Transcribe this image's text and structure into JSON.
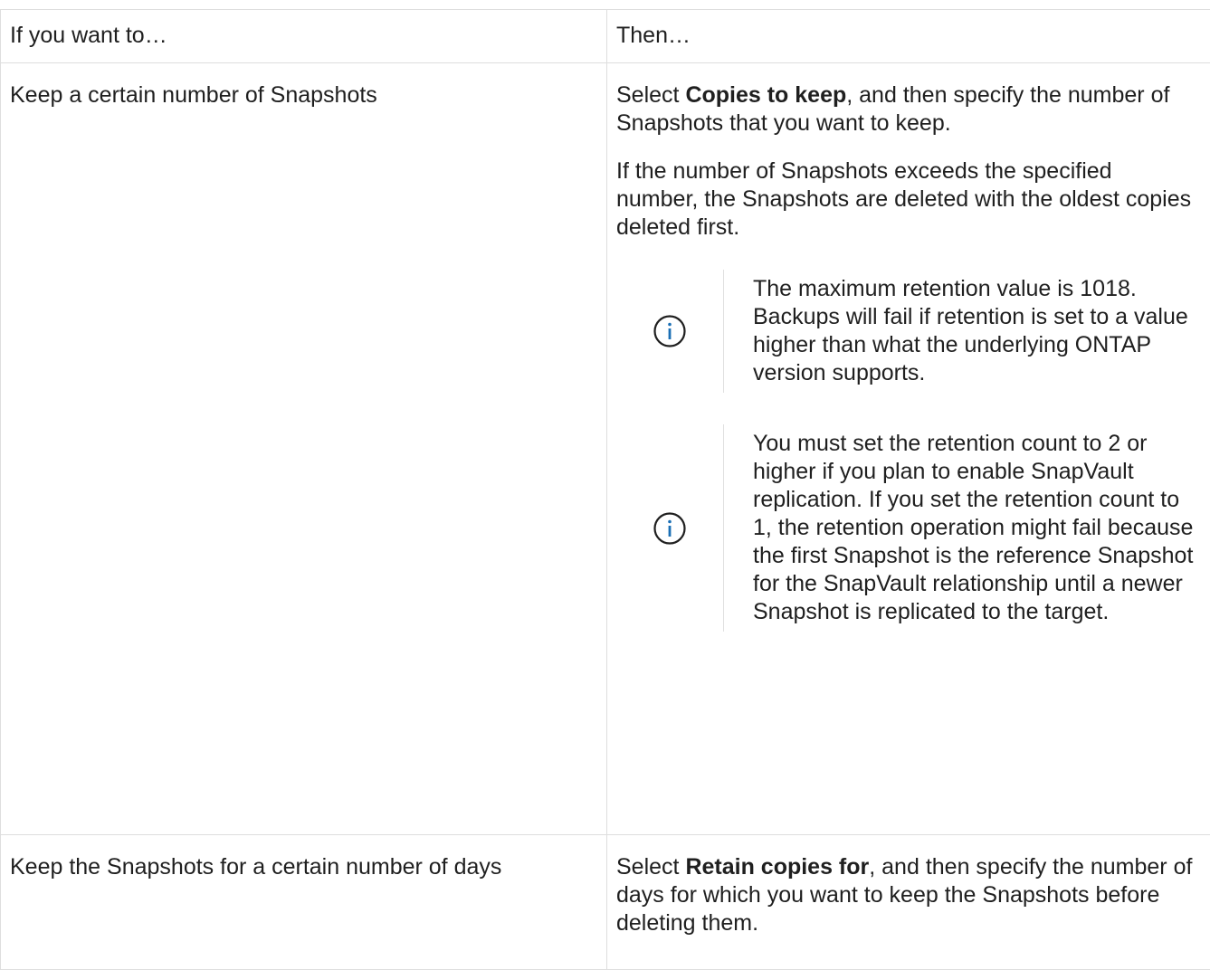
{
  "table": {
    "headers": [
      "If you want to…",
      "Then…"
    ],
    "rows": [
      {
        "action": "Keep a certain number of Snapshots",
        "then": {
          "para1_prefix": "Select ",
          "para1_bold": "Copies to keep",
          "para1_suffix": ", and then specify the number of Snapshots that you want to keep.",
          "para2": "If the number of Snapshots exceeds the specified number, the Snapshots are deleted with the oldest copies deleted first.",
          "notes": [
            {
              "icon": "info-icon",
              "text": "The maximum retention value is 1018. Backups will fail if retention is set to a value higher than what the underlying ONTAP version supports."
            },
            {
              "icon": "info-icon",
              "text": "You must set the retention count to 2 or higher if you plan to enable SnapVault replication. If you set the retention count to 1, the retention operation might fail because the first Snapshot is the reference Snapshot for the SnapVault relationship until a newer Snapshot is replicated to the target."
            }
          ]
        }
      },
      {
        "action": "Keep the Snapshots for a certain number of days",
        "then": {
          "para1_prefix": "Select ",
          "para1_bold": "Retain copies for",
          "para1_suffix": ", and then specify the number of days for which you want to keep the Snapshots before deleting them."
        }
      }
    ]
  },
  "colors": {
    "border": "#dedede",
    "text": "#1f1f1f",
    "info_icon": "#1b6fb5"
  }
}
